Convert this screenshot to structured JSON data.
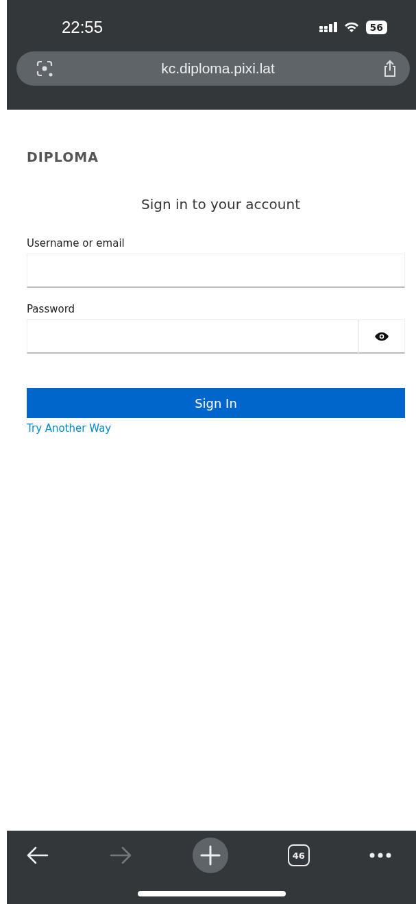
{
  "status_bar": {
    "time": "22:55",
    "battery": "56"
  },
  "address_bar": {
    "url": "kc.diploma.pixi.lat"
  },
  "brand": "DIPLOMA",
  "heading": "Sign in to your account",
  "fields": [
    {
      "label": "Username or email",
      "kind": "text"
    },
    {
      "label": "Password",
      "kind": "password"
    }
  ],
  "submit": "Sign In",
  "alt_link": "Try Another Way",
  "toolbar": {
    "back_disabled": false,
    "forward_disabled": true,
    "tabs_count": "46"
  }
}
